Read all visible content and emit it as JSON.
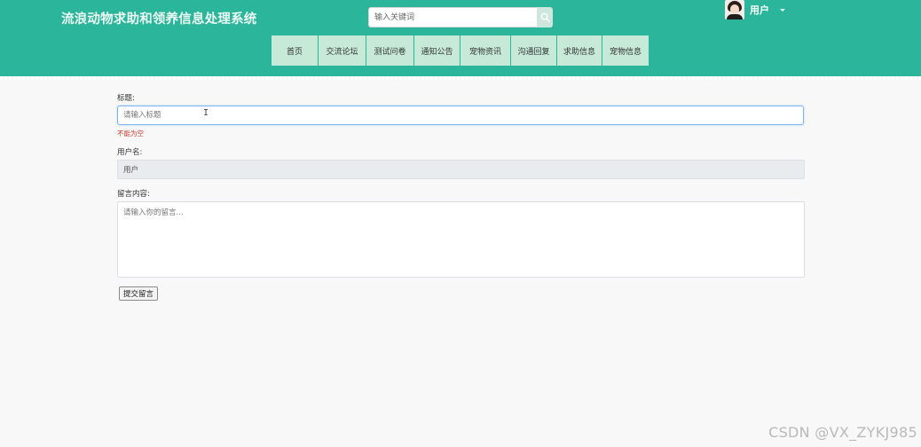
{
  "header": {
    "site_title": "流浪动物求助和领养信息处理系统",
    "search_placeholder": "输入关键词",
    "search_icon": "search-icon",
    "user_name": "用户",
    "accent_color": "#2bb59a",
    "nav_bg_color": "#c7ead8"
  },
  "nav": {
    "items": [
      {
        "label": "首页"
      },
      {
        "label": "交流论坛"
      },
      {
        "label": "测试问卷"
      },
      {
        "label": "通知公告"
      },
      {
        "label": "宠物资讯"
      },
      {
        "label": "沟通回复"
      },
      {
        "label": "求助信息"
      },
      {
        "label": "宠物信息"
      }
    ]
  },
  "form": {
    "title_label": "标题:",
    "title_placeholder": "请输入标题",
    "title_error": "不能为空",
    "username_label": "用户名:",
    "username_value": "用户",
    "message_label": "留言内容:",
    "message_placeholder": "请输入你的留言...",
    "submit_label": "提交留言"
  },
  "watermark": "CSDN @VX_ZYKJ985"
}
